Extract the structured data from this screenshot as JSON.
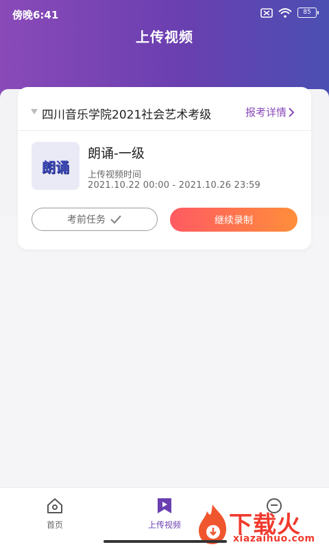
{
  "status_bar": {
    "time": "傍晚6:41",
    "battery": "85"
  },
  "page": {
    "title": "上传视频"
  },
  "card": {
    "exam_title": "四川音乐学院2021社会艺术考级",
    "details_label": "报考详情",
    "thumbnail_text": "朗诵",
    "item_title": "朗诵-一级",
    "time_label": "上传视频时间",
    "time_range": "2021.10.22 00:00 - 2021.10.26 23:59",
    "pretask_label": "考前任务",
    "continue_label": "继续录制"
  },
  "tabbar": {
    "items": [
      {
        "label": "首页",
        "icon": "home-icon",
        "active": false
      },
      {
        "label": "上传视频",
        "icon": "upload-video-icon",
        "active": true
      },
      {
        "label": "",
        "icon": "profile-icon",
        "active": false
      }
    ]
  },
  "watermark": {
    "text": "下载火",
    "subtext": "xiazaihuo.com"
  },
  "colors": {
    "accent": "#6a3fb0",
    "button_gradient_start": "#ff5a62",
    "button_gradient_end": "#ff8e3b"
  }
}
